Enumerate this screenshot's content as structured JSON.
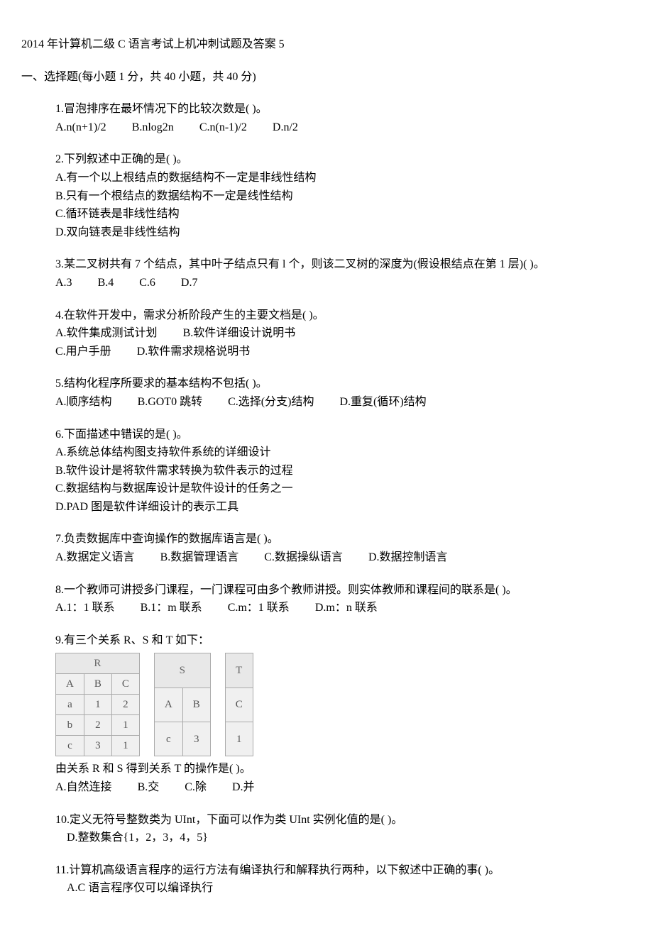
{
  "title": "2014 年计算机二级 C 语言考试上机冲刺试题及答案 5",
  "section1_header": "一、选择题(每小题 1 分，共 40 小题，共 40 分)",
  "q1": {
    "text": "1.冒泡排序在最坏情况下的比较次数是( )。",
    "a": "A.n(n+1)/2",
    "b": "B.nlog2n",
    "c": "C.n(n-1)/2",
    "d": "D.n/2"
  },
  "q2": {
    "text": "2.下列叙述中正确的是( )。",
    "a": "A.有一个以上根结点的数据结构不一定是非线性结构",
    "b": "B.只有一个根结点的数据结构不一定是线性结构",
    "c": "C.循环链表是非线性结构",
    "d": "D.双向链表是非线性结构"
  },
  "q3": {
    "text": "3.某二叉树共有 7 个结点，其中叶子结点只有 l 个，则该二叉树的深度为(假设根结点在第 1 层)( )。",
    "a": "A.3",
    "b": "B.4",
    "c": "C.6",
    "d": "D.7"
  },
  "q4": {
    "text": "4.在软件开发中，需求分析阶段产生的主要文档是( )。",
    "a": "A.软件集成测试计划",
    "b": "B.软件详细设计说明书",
    "c": "C.用户手册",
    "d": "D.软件需求规格说明书"
  },
  "q5": {
    "text": "5.结构化程序所要求的基本结构不包括( )。",
    "a": "A.顺序结构",
    "b": "B.GOT0 跳转",
    "c": "C.选择(分支)结构",
    "d": "D.重复(循环)结构"
  },
  "q6": {
    "text": "6.下面描述中错误的是( )。",
    "a": "A.系统总体结构图支持软件系统的详细设计",
    "b": "B.软件设计是将软件需求转换为软件表示的过程",
    "c": "C.数据结构与数据库设计是软件设计的任务之一",
    "d": "D.PAD 图是软件详细设计的表示工具"
  },
  "q7": {
    "text": "7.负责数据库中查询操作的数据库语言是( )。",
    "a": "A.数据定义语言",
    "b": "B.数据管理语言",
    "c": "C.数据操纵语言",
    "d": "D.数据控制语言"
  },
  "q8": {
    "text": "8.一个教师可讲授多门课程，一门课程可由多个教师讲授。则实体教师和课程间的联系是( )。",
    "a": "A.1：1 联系",
    "b": "B.1：m 联系",
    "c": "C.m：1 联系",
    "d": "D.m：n 联系"
  },
  "q9": {
    "text": "9.有三个关系 R、S 和 T 如下：",
    "tableR": {
      "name": "R",
      "headers": [
        "A",
        "B",
        "C"
      ],
      "rows": [
        [
          "a",
          "1",
          "2"
        ],
        [
          "b",
          "2",
          "1"
        ],
        [
          "c",
          "3",
          "1"
        ]
      ]
    },
    "tableS": {
      "name": "S",
      "headers": [
        "A",
        "B"
      ],
      "rows": [
        [
          "c",
          "3"
        ]
      ]
    },
    "tableT": {
      "name": "T",
      "headers": [
        "C"
      ],
      "rows": [
        [
          "1"
        ]
      ]
    },
    "text2": "由关系 R 和 S 得到关系 T 的操作是( )。",
    "a": "A.自然连接",
    "b": "B.交",
    "c": "C.除",
    "d": "D.并"
  },
  "q10": {
    "text": "10.定义无符号整数类为 UInt，下面可以作为类 UInt 实例化值的是( )。",
    "d": "D.整数集合{1，2，3，4，5}"
  },
  "q11": {
    "text": "11.计算机高级语言程序的运行方法有编译执行和解释执行两种，以下叙述中正确的事( )。",
    "a": "A.C 语言程序仅可以编译执行"
  }
}
